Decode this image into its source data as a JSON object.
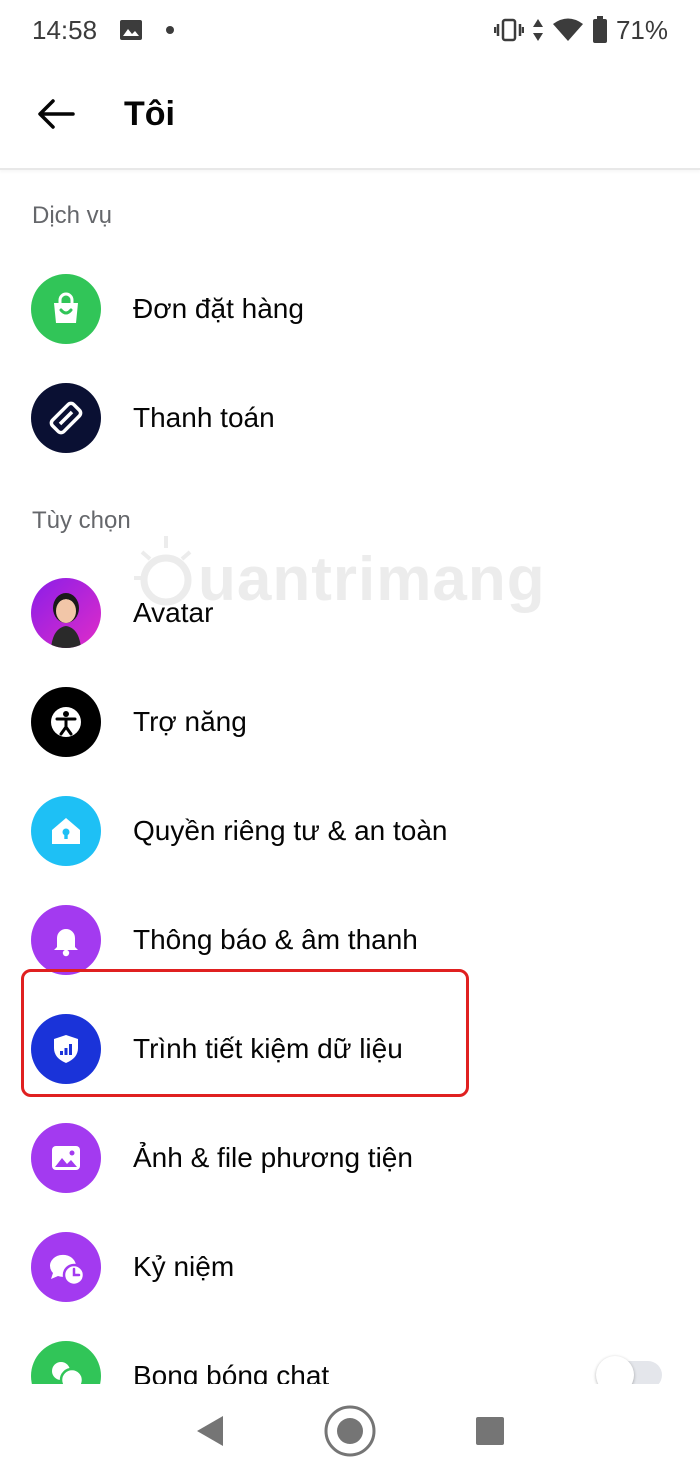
{
  "status_bar": {
    "time": "14:58",
    "battery": "71%",
    "icons": [
      "image-icon",
      "dot-icon",
      "vibrate-icon",
      "data-arrows-icon",
      "wifi-icon",
      "battery-icon"
    ]
  },
  "header": {
    "title": "Tôi",
    "back_icon": "arrow-left-icon"
  },
  "sections": [
    {
      "title": "Dịch vụ",
      "items": [
        {
          "label": "Đơn đặt hàng",
          "icon": "shopping-bag-icon",
          "icon_color": "#31c558"
        },
        {
          "label": "Thanh toán",
          "icon": "payment-card-icon",
          "icon_color": "#0a1033"
        }
      ]
    },
    {
      "title": "Tùy chọn",
      "items": [
        {
          "label": "Avatar",
          "icon": "avatar-icon",
          "icon_color": "#b51fe0"
        },
        {
          "label": "Trợ năng",
          "icon": "accessibility-icon",
          "icon_color": "#000000"
        },
        {
          "label": "Quyền riêng tư & an toàn",
          "icon": "privacy-house-icon",
          "icon_color": "#1ec0f5"
        },
        {
          "label": "Thông báo & âm thanh",
          "icon": "bell-icon",
          "icon_color": "#a33af0"
        },
        {
          "label": "Trình tiết kiệm dữ liệu",
          "icon": "data-saver-shield-icon",
          "icon_color": "#1a33d9",
          "highlighted": true
        },
        {
          "label": "Ảnh & file phương tiện",
          "icon": "photo-icon",
          "icon_color": "#a33af0"
        },
        {
          "label": "Kỷ niệm",
          "icon": "memories-clock-icon",
          "icon_color": "#a33af0"
        },
        {
          "label": "Bong bóng chat",
          "icon": "chat-bubbles-icon",
          "icon_color": "#31c558",
          "toggle": "off"
        }
      ]
    }
  ],
  "watermark": {
    "text": "uantrimang"
  },
  "nav_bar": {
    "icons": [
      "back-triangle-icon",
      "home-circle-icon",
      "recents-square-icon"
    ]
  }
}
